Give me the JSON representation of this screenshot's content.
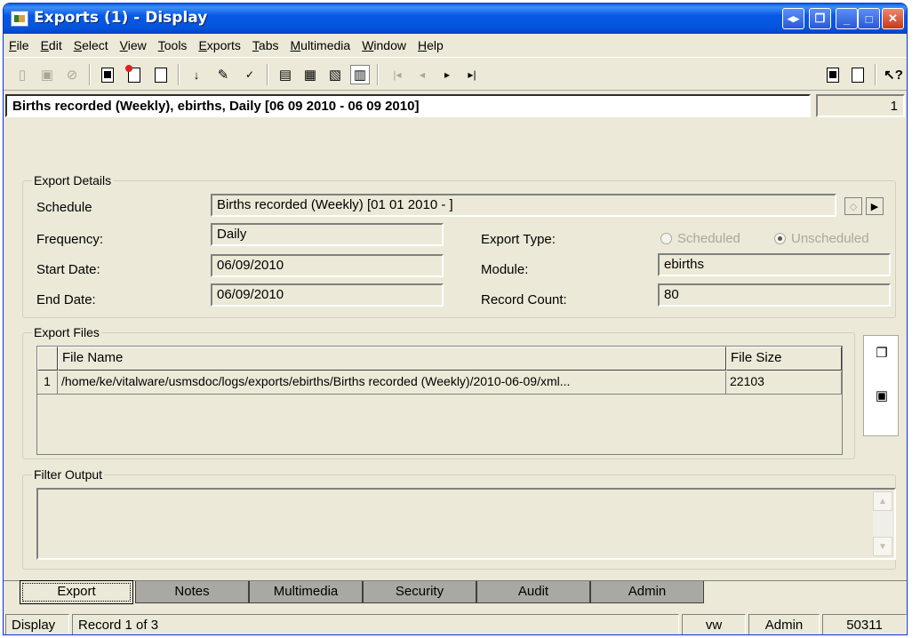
{
  "window": {
    "title": "Exports (1) - Display"
  },
  "menu": [
    "File",
    "Edit",
    "Select",
    "View",
    "Tools",
    "Exports",
    "Tabs",
    "Multimedia",
    "Window",
    "Help"
  ],
  "record": {
    "header": "Births recorded (Weekly), ebirths, Daily [06 09 2010 - 06 09 2010]",
    "number": "1"
  },
  "export_details": {
    "group_label": "Export Details",
    "schedule_label": "Schedule",
    "schedule_value": "Births recorded (Weekly) [01 01 2010 - ]",
    "frequency_label": "Frequency:",
    "frequency_value": "Daily",
    "start_label": "Start Date:",
    "start_value": "06/09/2010",
    "end_label": "End Date:",
    "end_value": "06/09/2010",
    "type_label": "Export Type:",
    "type_scheduled": "Scheduled",
    "type_unscheduled": "Unscheduled",
    "module_label": "Module:",
    "module_value": "ebirths",
    "count_label": "Record Count:",
    "count_value": "80"
  },
  "export_files": {
    "group_label": "Export Files",
    "col_name": "File Name",
    "col_size": "File Size",
    "rows": [
      {
        "index": "1",
        "name": "/home/ke/vitalware/usmsdoc/logs/exports/ebirths/Births recorded (Weekly)/2010-06-09/xml...",
        "size": "22103"
      }
    ]
  },
  "filter_output": {
    "group_label": "Filter Output",
    "value": ""
  },
  "tabs": [
    "Export",
    "Notes",
    "Multimedia",
    "Security",
    "Audit",
    "Admin"
  ],
  "status": {
    "mode": "Display",
    "record": "Record 1 of 3",
    "user": "vw",
    "group": "Admin",
    "id": "50311"
  }
}
